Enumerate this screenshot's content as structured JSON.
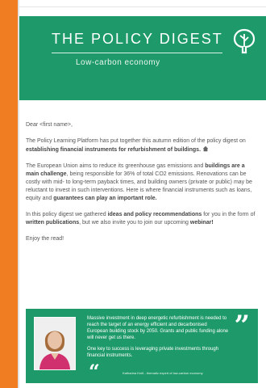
{
  "header": {
    "title": "THE POLICY DIGEST",
    "subtitle": "Low-carbon economy",
    "icon": "tree-icon"
  },
  "body": {
    "greeting": "Dear <first name>,",
    "p1_a": "The Policy Learning Platform has put together this autumn edition of the policy digest on ",
    "p1_b": "establishing financial instruments for refurbishment of buildings.",
    "p2_a": "The European Union aims to reduce its greenhouse gas emissions and ",
    "p2_b": "buildings are a main challenge",
    "p2_c": ", being responsible for 36% of total CO2 emissions. Renovations can be costly with mid- to long-term payback times, and building owners (private or public) may be reluctant to invest in such interventions. Here is where financial instruments such as loans, equity and ",
    "p2_d": "guarantees can play an important role.",
    "p3_a": "In this policy digest we gathered ",
    "p3_b": "ideas and policy recommendations",
    "p3_c": " for you in the form of ",
    "p3_d": "written publications",
    "p3_e": ", but we also invite you to join our upcoming ",
    "p3_f": "webinar!",
    "closing": "Enjoy the read!"
  },
  "quote": {
    "line1": "Massive investment in deep energetic refurbishment is needed to reach the target of an energy efficient and decarbonised European building stock by 2050. Grants and public funding alone will never get us there.",
    "line2": "One key to success is leveraging private investments through financial instruments.",
    "author": "Katharina Krell - thematic expert of low-carbon economy",
    "open_mark": "“",
    "close_mark": "”"
  },
  "colors": {
    "accent_orange": "#f07d22",
    "brand_green": "#1e9a6a"
  }
}
